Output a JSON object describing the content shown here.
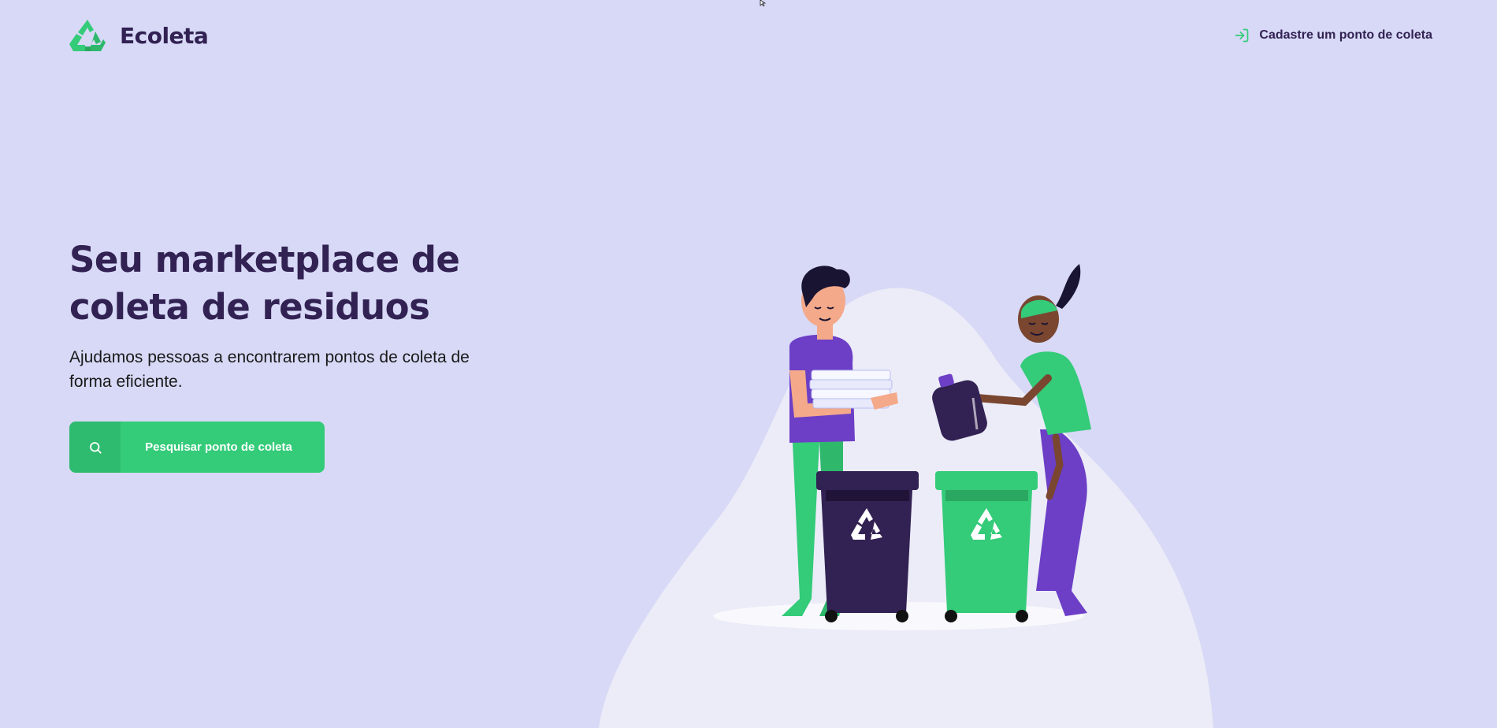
{
  "header": {
    "logo_text": "Ecoleta",
    "link_label": "Cadastre um ponto de coleta",
    "link_icon": "log-in-icon"
  },
  "hero": {
    "title_line1": "Seu marketplace de",
    "title_line2": "coleta de residuos",
    "subtitle": "Ajudamos pessoas a encontrarem pontos de coleta de forma eficiente."
  },
  "search_button": {
    "label": "Pesquisar ponto de coleta",
    "icon": "search-icon"
  },
  "colors": {
    "background": "#d7d9f6",
    "primary": "#34cb79",
    "title": "#322153"
  }
}
